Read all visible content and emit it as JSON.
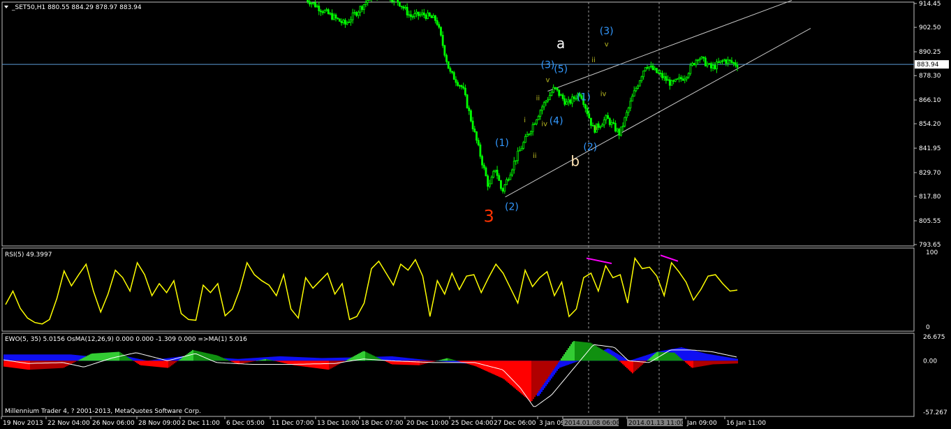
{
  "colors": {
    "background": "#000000",
    "frame": "#c0c0c0",
    "candles": "#00ff00",
    "price_line": "#5b9bd5",
    "rsi_line": "#ffff00",
    "rsi_divergence": "#ff00ff",
    "ewo_positive_rising": "#33cc33",
    "ewo_positive_falling": "#109010",
    "ewo_negative_falling": "#ff0000",
    "ewo_negative_rising": "#b00000",
    "osma_positive": "#1010ff",
    "osma_negative": "#1010ff",
    "ma_line": "#ffffff",
    "wave_blue": "#3399ff",
    "wave_yellow": "#bbbb22",
    "wave_white": "#ffffff",
    "wave_peach": "#ffe4b5",
    "wave_red": "#ff3300",
    "trendlines": "#c8c8c8",
    "vlines": "#9a9a9a",
    "current_price_box": "#ffffff"
  },
  "header": {
    "symbol_label": "_SET50,H1  880.55 884.29 878.97 883.94",
    "rsi_label": "RSI(5) 49.3997",
    "ewo_label": "EWO(5, 35) 5.0156  OsMA(12,26,9) 0.000 0.000 -1.309 0.000   =>MA(1) 5.016",
    "copyright": "Millennium Trader 4, ? 2001-2013, MetaQuotes Software Corp."
  },
  "chart_data": [
    {
      "type": "candlestick",
      "title": "_SET50,H1",
      "ohlc_current": {
        "open": 880.55,
        "high": 884.29,
        "low": 878.97,
        "close": 883.94
      },
      "ylim": [
        793.65,
        914.45
      ],
      "yticks": [
        "914.45",
        "902.50",
        "890.25",
        "878.30",
        "866.10",
        "854.20",
        "841.95",
        "829.70",
        "817.80",
        "805.55",
        "793.65"
      ],
      "current_price": 883.94,
      "current_price_label": "883.94",
      "approx_close_path": {
        "x_index": [
          0,
          3,
          6,
          8,
          10,
          12,
          14,
          16,
          18,
          20,
          22,
          24,
          26,
          28,
          29,
          30,
          32,
          34,
          36,
          38,
          40,
          42,
          44,
          46,
          48,
          50,
          52,
          54,
          56,
          58,
          60,
          62,
          64,
          66
        ],
        "close": [
          917,
          910,
          904,
          911,
          918,
          919,
          916,
          908,
          909,
          906,
          880,
          872,
          847,
          822,
          832,
          820,
          836,
          849,
          862,
          872,
          864,
          870,
          851,
          857,
          849,
          868,
          884,
          879,
          874,
          878,
          888,
          882,
          886,
          883.94
        ]
      },
      "annotations": [
        {
          "text": "3",
          "color": "wave_red",
          "price": 805,
          "x_index": 28
        },
        {
          "text": "(1)",
          "color": "wave_blue",
          "price": 843,
          "x_index": 30
        },
        {
          "text": "(2)",
          "color": "wave_blue",
          "price": 811,
          "x_index": 31.5
        },
        {
          "text": "i",
          "color": "wave_yellow",
          "price": 855,
          "x_index": 33.5
        },
        {
          "text": "ii",
          "color": "wave_yellow",
          "price": 837,
          "x_index": 35
        },
        {
          "text": "ii",
          "color": "wave_yellow",
          "price": 866,
          "x_index": 35.5
        },
        {
          "text": "iv",
          "color": "wave_yellow",
          "price": 853,
          "x_index": 36.5
        },
        {
          "text": "(3)",
          "color": "wave_blue",
          "price": 882,
          "x_index": 37
        },
        {
          "text": "v",
          "color": "wave_yellow",
          "price": 875,
          "x_index": 37
        },
        {
          "text": "(4)",
          "color": "wave_blue",
          "price": 854,
          "x_index": 38.3
        },
        {
          "text": "(5)",
          "color": "wave_blue",
          "price": 880,
          "x_index": 39
        },
        {
          "text": "a",
          "color": "wave_white",
          "price": 892,
          "x_index": 39
        },
        {
          "text": "b",
          "color": "wave_peach",
          "price": 833,
          "x_index": 41.2
        },
        {
          "text": "(1)",
          "color": "wave_blue",
          "price": 866,
          "x_index": 42.5
        },
        {
          "text": "(2)",
          "color": "wave_blue",
          "price": 841,
          "x_index": 43.5
        },
        {
          "text": "ii",
          "color": "wave_yellow",
          "price": 885,
          "x_index": 44
        },
        {
          "text": "iv",
          "color": "wave_yellow",
          "price": 868,
          "x_index": 45.5
        },
        {
          "text": "ii",
          "color": "wave_yellow",
          "price": 851,
          "x_index": 44.3
        },
        {
          "text": "(3)",
          "color": "wave_blue",
          "price": 899,
          "x_index": 46
        },
        {
          "text": "v",
          "color": "wave_yellow",
          "price": 893,
          "x_index": 46
        }
      ],
      "xticks": [
        "19 Nov 2013",
        "22 Nov 04:00",
        "26 Nov 06:00",
        "28 Nov 09:00",
        "2 Dec 11:00",
        "6 Dec 05:00",
        "11 Dec 07:00",
        "13 Dec 10:00",
        "18 Dec 07:00",
        "20 Dec 10:00",
        "25 Dec 04:00",
        "27 Dec 06:00",
        "3 Jan 09:00",
        "2014.01.08 06:00",
        "2014.01.13 11:00",
        "Jan 09:00",
        "16 Jan 11:00"
      ]
    },
    {
      "type": "line",
      "title": "RSI(5) 49.3997",
      "ylim": [
        0,
        100
      ],
      "yticks": [
        "100",
        "0"
      ],
      "values": [
        30,
        48,
        25,
        12,
        6,
        4,
        10,
        38,
        75,
        55,
        70,
        84,
        48,
        20,
        44,
        76,
        66,
        48,
        86,
        70,
        42,
        58,
        46,
        62,
        18,
        10,
        9,
        56,
        46,
        58,
        15,
        24,
        50,
        86,
        70,
        62,
        56,
        42,
        70,
        24,
        12,
        66,
        52,
        62,
        72,
        44,
        58,
        10,
        14,
        32,
        78,
        88,
        72,
        56,
        84,
        76,
        90,
        68,
        14,
        62,
        44,
        72,
        50,
        68,
        70,
        46,
        66,
        84,
        72,
        52,
        32,
        76,
        54,
        66,
        74,
        42,
        60,
        14,
        24,
        66,
        72,
        48,
        82,
        66,
        70,
        32,
        92,
        78,
        80,
        68,
        42,
        86,
        74,
        60,
        36,
        50,
        68,
        70,
        58,
        48,
        49.4
      ],
      "divergence_lines": [
        {
          "from_value": 92,
          "to_value": 85,
          "span": "2014.01.08"
        },
        {
          "from_value": 96,
          "to_value": 88,
          "span": "2014.01.13"
        }
      ]
    },
    {
      "type": "bar",
      "title": "EWO(5, 35)",
      "ylim": [
        -57.267,
        26.675
      ],
      "yticks": [
        "26.675",
        "0.00",
        "-57.267"
      ],
      "ewo_current": 5.0156,
      "osma_current": 0.0,
      "ma_current": 5.016
    }
  ]
}
